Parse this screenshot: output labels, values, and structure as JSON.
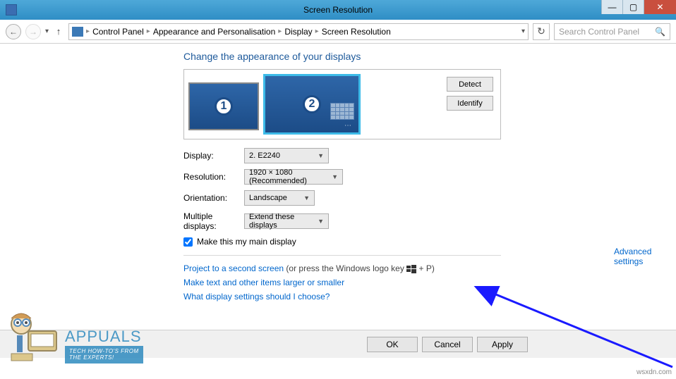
{
  "window": {
    "title": "Screen Resolution"
  },
  "breadcrumb": {
    "items": [
      "Control Panel",
      "Appearance and Personalisation",
      "Display",
      "Screen Resolution"
    ]
  },
  "search": {
    "placeholder": "Search Control Panel"
  },
  "page": {
    "header": "Change the appearance of your displays"
  },
  "preview": {
    "monitor1": "1",
    "monitor2": "2",
    "detect": "Detect",
    "identify": "Identify"
  },
  "settings": {
    "display_label": "Display:",
    "display_value": "2. E2240",
    "resolution_label": "Resolution:",
    "resolution_value": "1920 × 1080 (Recommended)",
    "orientation_label": "Orientation:",
    "orientation_value": "Landscape",
    "multiple_label": "Multiple displays:",
    "multiple_value": "Extend these displays",
    "main_display_label": "Make this my main display",
    "main_display_checked": true,
    "advanced_link": "Advanced settings"
  },
  "links": {
    "project_link": "Project to a second screen",
    "project_suffix": " (or press the Windows logo key ",
    "project_suffix2": " + P)",
    "larger_text": "Make text and other items larger or smaller",
    "help": "What display settings should I choose?"
  },
  "buttons": {
    "ok": "OK",
    "cancel": "Cancel",
    "apply": "Apply"
  },
  "watermark": {
    "brand": "APPUALS",
    "tagline1": "TECH HOW-TO'S FROM",
    "tagline2": "THE EXPERTS!"
  },
  "credit": "wsxdn.com"
}
